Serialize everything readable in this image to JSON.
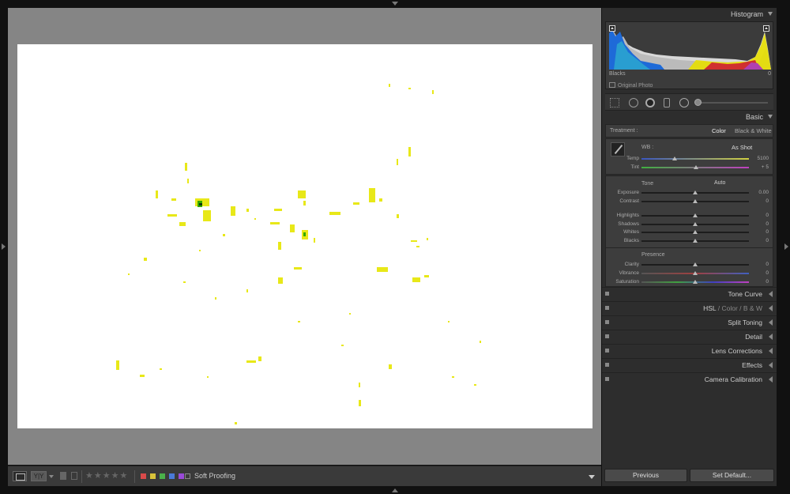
{
  "histogram": {
    "title": "Histogram",
    "info_label": "Blacks",
    "info_value": "0",
    "original_photo": "Original Photo"
  },
  "basic": {
    "title": "Basic",
    "treatment_label": "Treatment :",
    "treatment_color": "Color",
    "treatment_bw": "Black & White",
    "wb_label": "WB :",
    "wb_value": "As Shot",
    "temp": {
      "label": "Temp",
      "value": "5100",
      "position": 0.31
    },
    "tint": {
      "label": "Tint",
      "value": "+ 5",
      "position": 0.51
    },
    "tone_title": "Tone",
    "tone_auto": "Auto",
    "exposure": {
      "label": "Exposure",
      "value": "0.00",
      "position": 0.5
    },
    "contrast": {
      "label": "Contrast",
      "value": "0",
      "position": 0.5
    },
    "highlights": {
      "label": "Highlights",
      "value": "0",
      "position": 0.5
    },
    "shadows": {
      "label": "Shadows",
      "value": "0",
      "position": 0.5
    },
    "whites": {
      "label": "Whites",
      "value": "0",
      "position": 0.5
    },
    "blacks": {
      "label": "Blacks",
      "value": "0",
      "position": 0.5
    },
    "presence_title": "Presence",
    "clarity": {
      "label": "Clarity",
      "value": "0",
      "position": 0.5
    },
    "vibrance": {
      "label": "Vibrance",
      "value": "0",
      "position": 0.5
    },
    "saturation": {
      "label": "Saturation",
      "value": "0",
      "position": 0.5
    }
  },
  "panels": {
    "tone_curve": "Tone Curve",
    "hsl": "HSL",
    "hsl_sep": "/",
    "hsl_color": "Color",
    "hsl_sep2": "/",
    "hsl_bw": "B & W",
    "split_toning": "Split Toning",
    "detail": "Detail",
    "lens_corrections": "Lens Corrections",
    "effects": "Effects",
    "camera_calibration": "Camera Calibration"
  },
  "toolbar": {
    "stars": "★★★★★",
    "soft_proofing": "Soft Proofing",
    "yy": "Y|Y",
    "colors": [
      "#d84a4a",
      "#d8c23a",
      "#4ab04a",
      "#4a7ad8",
      "#9a4ad8"
    ]
  },
  "buttons": {
    "previous": "Previous",
    "set_default": "Set Default..."
  },
  "icons": {
    "crop": "crop-overlay-icon",
    "spot": "spot-removal-icon",
    "redeye": "red-eye-icon",
    "gradient": "graduated-filter-icon",
    "radial": "radial-filter-icon",
    "brush": "adjustment-brush-icon"
  }
}
